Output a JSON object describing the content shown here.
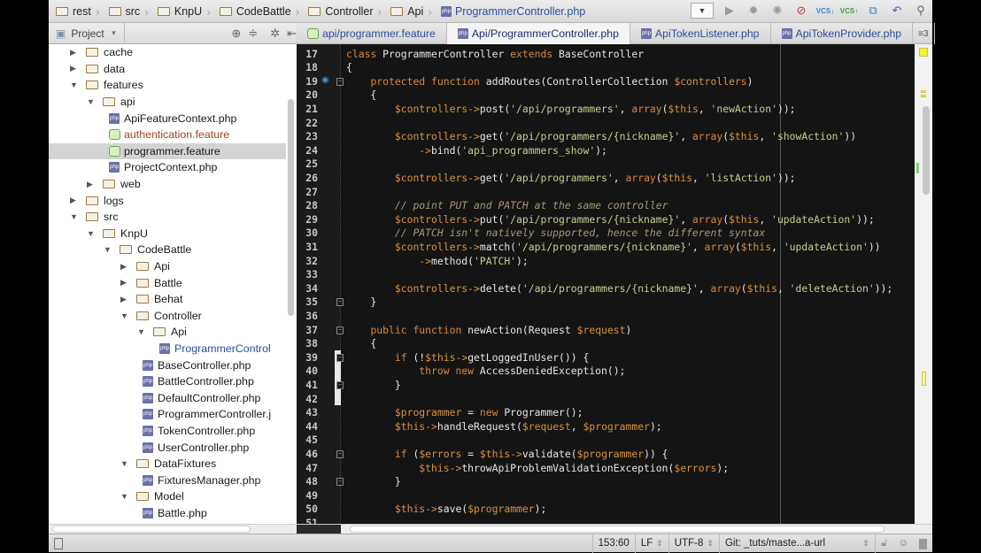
{
  "breadcrumb": [
    "rest",
    "src",
    "KnpU",
    "CodeBattle",
    "Controller",
    "Api"
  ],
  "breadcrumb_file": "ProgrammerController.php",
  "project_panel": {
    "label": "Project"
  },
  "tabs": [
    {
      "label": "api/programmer.feature",
      "icon": "feature",
      "active": false
    },
    {
      "label": "Api/ProgrammerController.php",
      "icon": "php",
      "active": true
    },
    {
      "label": "ApiTokenListener.php",
      "icon": "php",
      "active": false
    },
    {
      "label": "ApiTokenProvider.php",
      "icon": "php",
      "active": false
    }
  ],
  "tabs_more": "≡3",
  "tree": [
    {
      "label": "cache",
      "level": 1,
      "type": "folder",
      "state": "collapsed"
    },
    {
      "label": "data",
      "level": 1,
      "type": "folder",
      "state": "collapsed"
    },
    {
      "label": "features",
      "level": 1,
      "type": "folder",
      "state": "expanded"
    },
    {
      "label": "api",
      "level": 2,
      "type": "folder",
      "state": "expanded"
    },
    {
      "label": "ApiFeatureContext.php",
      "level": 3,
      "type": "php"
    },
    {
      "label": "authentication.feature",
      "level": 3,
      "type": "feature",
      "color": "#a0441c"
    },
    {
      "label": "programmer.feature",
      "level": 3,
      "type": "feature",
      "selected": true
    },
    {
      "label": "ProjectContext.php",
      "level": 3,
      "type": "php"
    },
    {
      "label": "web",
      "level": 2,
      "type": "folder",
      "state": "collapsed"
    },
    {
      "label": "logs",
      "level": 1,
      "type": "folder",
      "state": "collapsed"
    },
    {
      "label": "src",
      "level": 1,
      "type": "folder",
      "state": "expanded"
    },
    {
      "label": "KnpU",
      "level": 2,
      "type": "folder",
      "state": "expanded"
    },
    {
      "label": "CodeBattle",
      "level": 3,
      "type": "folder",
      "state": "expanded"
    },
    {
      "label": "Api",
      "level": 4,
      "type": "folder",
      "state": "collapsed"
    },
    {
      "label": "Battle",
      "level": 4,
      "type": "folder",
      "state": "collapsed"
    },
    {
      "label": "Behat",
      "level": 4,
      "type": "folder",
      "state": "collapsed"
    },
    {
      "label": "Controller",
      "level": 4,
      "type": "folder",
      "state": "expanded"
    },
    {
      "label": "Api",
      "level": 5,
      "type": "folder",
      "state": "expanded"
    },
    {
      "label": "ProgrammerControl",
      "level": 6,
      "type": "php",
      "color": "#2b4fa0"
    },
    {
      "label": "BaseController.php",
      "level": 5,
      "type": "php"
    },
    {
      "label": "BattleController.php",
      "level": 5,
      "type": "php"
    },
    {
      "label": "DefaultController.php",
      "level": 5,
      "type": "php"
    },
    {
      "label": "ProgrammerController.j",
      "level": 5,
      "type": "php"
    },
    {
      "label": "TokenController.php",
      "level": 5,
      "type": "php"
    },
    {
      "label": "UserController.php",
      "level": 5,
      "type": "php"
    },
    {
      "label": "DataFixtures",
      "level": 4,
      "type": "folder",
      "state": "expanded"
    },
    {
      "label": "FixturesManager.php",
      "level": 5,
      "type": "php"
    },
    {
      "label": "Model",
      "level": 4,
      "type": "folder",
      "state": "expanded"
    },
    {
      "label": "Battle.php",
      "level": 5,
      "type": "php"
    }
  ],
  "code": {
    "first_line": 17,
    "lines": [
      [
        [
          "k",
          "class "
        ],
        [
          "p",
          "ProgrammerController "
        ],
        [
          "k",
          "extends "
        ],
        [
          "p",
          "BaseController"
        ]
      ],
      [
        [
          "p",
          "{"
        ]
      ],
      [
        [
          "p",
          "    "
        ],
        [
          "k",
          "protected function "
        ],
        [
          "p",
          "addRoutes(ControllerCollection "
        ],
        [
          "v",
          "$controllers"
        ],
        [
          "p",
          ")"
        ]
      ],
      [
        [
          "p",
          "    {"
        ]
      ],
      [
        [
          "p",
          "        "
        ],
        [
          "v",
          "$controllers->"
        ],
        [
          "p",
          "post("
        ],
        [
          "s",
          "'/api/programmers'"
        ],
        [
          "p",
          ", "
        ],
        [
          "k",
          "array"
        ],
        [
          "p",
          "("
        ],
        [
          "v",
          "$this"
        ],
        [
          "p",
          ", "
        ],
        [
          "s",
          "'newAction'"
        ],
        [
          "p",
          "));"
        ]
      ],
      [],
      [
        [
          "p",
          "        "
        ],
        [
          "v",
          "$controllers->"
        ],
        [
          "p",
          "get("
        ],
        [
          "s",
          "'/api/programmers/{nickname}'"
        ],
        [
          "p",
          ", "
        ],
        [
          "k",
          "array"
        ],
        [
          "p",
          "("
        ],
        [
          "v",
          "$this"
        ],
        [
          "p",
          ", "
        ],
        [
          "s",
          "'showAction'"
        ],
        [
          "p",
          "))"
        ]
      ],
      [
        [
          "p",
          "            "
        ],
        [
          "v",
          "->"
        ],
        [
          "p",
          "bind("
        ],
        [
          "s",
          "'api_programmers_show'"
        ],
        [
          "p",
          ");"
        ]
      ],
      [],
      [
        [
          "p",
          "        "
        ],
        [
          "v",
          "$controllers->"
        ],
        [
          "p",
          "get("
        ],
        [
          "s",
          "'/api/programmers'"
        ],
        [
          "p",
          ", "
        ],
        [
          "k",
          "array"
        ],
        [
          "p",
          "("
        ],
        [
          "v",
          "$this"
        ],
        [
          "p",
          ", "
        ],
        [
          "s",
          "'listAction'"
        ],
        [
          "p",
          "));"
        ]
      ],
      [],
      [
        [
          "p",
          "        "
        ],
        [
          "c",
          "// point PUT and PATCH at the same controller"
        ]
      ],
      [
        [
          "p",
          "        "
        ],
        [
          "v",
          "$controllers->"
        ],
        [
          "p",
          "put("
        ],
        [
          "s",
          "'/api/programmers/{nickname}'"
        ],
        [
          "p",
          ", "
        ],
        [
          "k",
          "array"
        ],
        [
          "p",
          "("
        ],
        [
          "v",
          "$this"
        ],
        [
          "p",
          ", "
        ],
        [
          "s",
          "'updateAction'"
        ],
        [
          "p",
          "));"
        ]
      ],
      [
        [
          "p",
          "        "
        ],
        [
          "c",
          "// PATCH isn't natively supported, hence the different syntax"
        ]
      ],
      [
        [
          "p",
          "        "
        ],
        [
          "v",
          "$controllers->"
        ],
        [
          "p",
          "match("
        ],
        [
          "s",
          "'/api/programmers/{nickname}'"
        ],
        [
          "p",
          ", "
        ],
        [
          "k",
          "array"
        ],
        [
          "p",
          "("
        ],
        [
          "v",
          "$this"
        ],
        [
          "p",
          ", "
        ],
        [
          "s",
          "'updateAction'"
        ],
        [
          "p",
          "))"
        ]
      ],
      [
        [
          "p",
          "            "
        ],
        [
          "v",
          "->"
        ],
        [
          "p",
          "method("
        ],
        [
          "s",
          "'PATCH'"
        ],
        [
          "p",
          ");"
        ]
      ],
      [],
      [
        [
          "p",
          "        "
        ],
        [
          "v",
          "$controllers->"
        ],
        [
          "p",
          "delete("
        ],
        [
          "s",
          "'/api/programmers/{nickname}'"
        ],
        [
          "p",
          ", "
        ],
        [
          "k",
          "array"
        ],
        [
          "p",
          "("
        ],
        [
          "v",
          "$this"
        ],
        [
          "p",
          ", "
        ],
        [
          "s",
          "'deleteAction'"
        ],
        [
          "p",
          "));"
        ]
      ],
      [
        [
          "p",
          "    }"
        ]
      ],
      [],
      [
        [
          "p",
          "    "
        ],
        [
          "k",
          "public function "
        ],
        [
          "p",
          "newAction(Request "
        ],
        [
          "v",
          "$request"
        ],
        [
          "p",
          ")"
        ]
      ],
      [
        [
          "p",
          "    {"
        ]
      ],
      [
        [
          "p",
          "        "
        ],
        [
          "k",
          "if "
        ],
        [
          "p",
          "(!"
        ],
        [
          "v",
          "$this->"
        ],
        [
          "p",
          "getLoggedInUser()) {"
        ]
      ],
      [
        [
          "p",
          "            "
        ],
        [
          "k",
          "throw new "
        ],
        [
          "p",
          "AccessDeniedException();"
        ]
      ],
      [
        [
          "p",
          "        }"
        ]
      ],
      [],
      [
        [
          "p",
          "        "
        ],
        [
          "v",
          "$programmer"
        ],
        [
          "p",
          " = "
        ],
        [
          "k",
          "new "
        ],
        [
          "p",
          "Programmer();"
        ]
      ],
      [
        [
          "p",
          "        "
        ],
        [
          "v",
          "$this->"
        ],
        [
          "p",
          "handleRequest("
        ],
        [
          "v",
          "$request"
        ],
        [
          "p",
          ", "
        ],
        [
          "v",
          "$programmer"
        ],
        [
          "p",
          ");"
        ]
      ],
      [],
      [
        [
          "p",
          "        "
        ],
        [
          "k",
          "if "
        ],
        [
          "p",
          "("
        ],
        [
          "v",
          "$errors"
        ],
        [
          "p",
          " = "
        ],
        [
          "v",
          "$this->"
        ],
        [
          "p",
          "validate("
        ],
        [
          "v",
          "$programmer"
        ],
        [
          "p",
          ")) {"
        ]
      ],
      [
        [
          "p",
          "            "
        ],
        [
          "v",
          "$this->"
        ],
        [
          "p",
          "throwApiProblemValidationException("
        ],
        [
          "v",
          "$errors"
        ],
        [
          "p",
          ");"
        ]
      ],
      [
        [
          "p",
          "        }"
        ]
      ],
      [],
      [
        [
          "p",
          "        "
        ],
        [
          "v",
          "$this->"
        ],
        [
          "p",
          "save("
        ],
        [
          "v",
          "$programmer"
        ],
        [
          "p",
          ");"
        ]
      ],
      []
    ]
  },
  "status": {
    "position": "153:60",
    "line_sep": "LF",
    "encoding": "UTF-8",
    "vcs": "Git: _tuts/maste...a-url"
  }
}
